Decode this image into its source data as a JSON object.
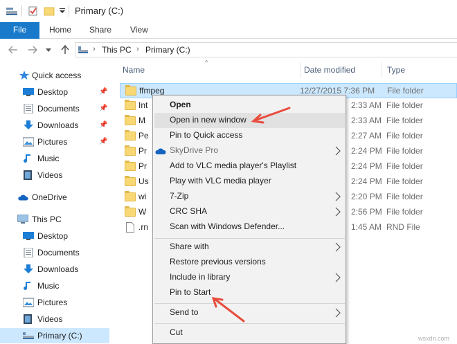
{
  "window": {
    "title": "Primary (C:)"
  },
  "ribbon": {
    "tabs": [
      "File",
      "Home",
      "Share",
      "View"
    ]
  },
  "address": {
    "segments": [
      "This PC",
      "Primary (C:)"
    ]
  },
  "nav": {
    "quick_access": "Quick access",
    "quick_items": [
      "Desktop",
      "Documents",
      "Downloads",
      "Pictures",
      "Music",
      "Videos"
    ],
    "onedrive": "OneDrive",
    "this_pc": "This PC",
    "pc_items": [
      "Desktop",
      "Documents",
      "Downloads",
      "Music",
      "Pictures",
      "Videos",
      "Primary (C:)"
    ]
  },
  "columns": {
    "name": "Name",
    "date": "Date modified",
    "type": "Type"
  },
  "files": [
    {
      "name": "ffmpeg",
      "date": "12/27/2015 7:36 PM",
      "type": "File folder"
    },
    {
      "name": "Int",
      "date": "2:33 AM",
      "type": "File folder"
    },
    {
      "name": "M",
      "date": "2:33 AM",
      "type": "File folder"
    },
    {
      "name": "Pe",
      "date": "2:27 AM",
      "type": "File folder"
    },
    {
      "name": "Pr",
      "date": "2:24 PM",
      "type": "File folder"
    },
    {
      "name": "Pr",
      "date": "2:24 PM",
      "type": "File folder"
    },
    {
      "name": "Us",
      "date": "2:24 PM",
      "type": "File folder"
    },
    {
      "name": "wi",
      "date": "2:20 PM",
      "type": "File folder"
    },
    {
      "name": "W",
      "date": "2:56 PM",
      "type": "File folder"
    },
    {
      "name": ".rn",
      "date": "1:45 AM",
      "type": "RND File"
    }
  ],
  "context_menu": {
    "open": "Open",
    "open_new_window": "Open in new window",
    "pin_quick_access": "Pin to Quick access",
    "skydrive_pro": "SkyDrive Pro",
    "add_vlc_playlist": "Add to VLC media player's Playlist",
    "play_vlc": "Play with VLC media player",
    "seven_zip": "7-Zip",
    "crc_sha": "CRC SHA",
    "scan_defender": "Scan with Windows Defender...",
    "share_with": "Share with",
    "restore_versions": "Restore previous versions",
    "include_library": "Include in library",
    "pin_start": "Pin to Start",
    "send_to": "Send to",
    "cut": "Cut"
  },
  "watermark": "wsxdn.com",
  "colors": {
    "accent": "#1979ca",
    "selection": "#cce8ff",
    "annotation": "#e84c3d"
  }
}
